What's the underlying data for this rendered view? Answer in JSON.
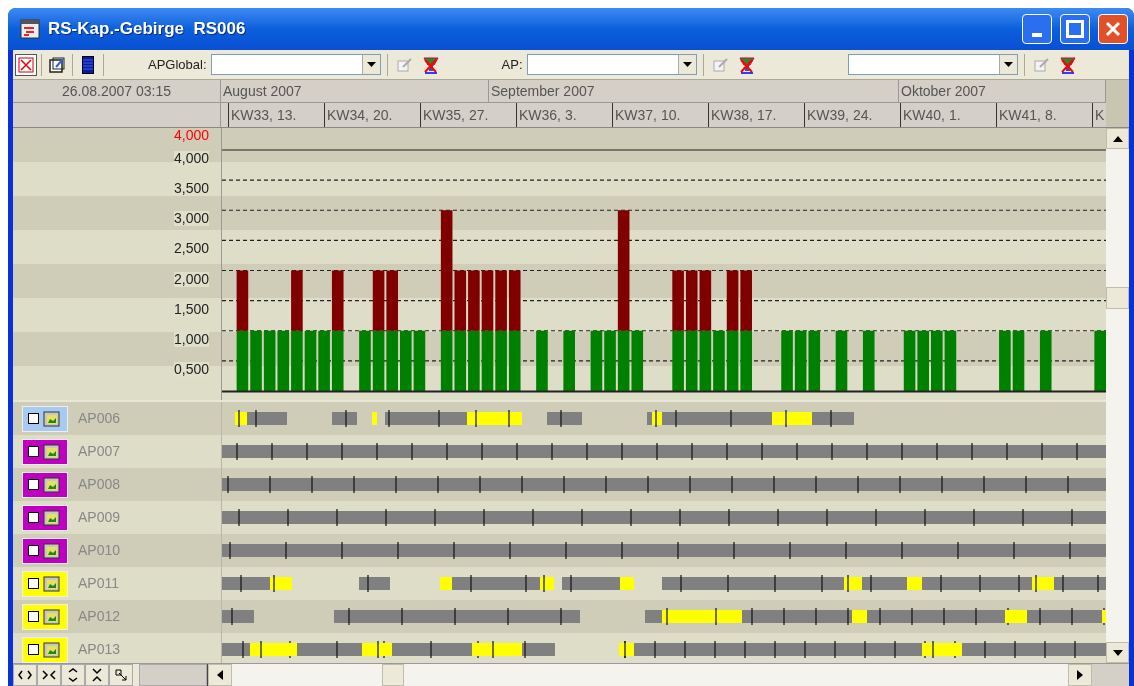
{
  "window": {
    "title": "RS-Kap.-Gebirge  RS006"
  },
  "toolbar": {
    "combos": [
      {
        "kind": "labeled",
        "label": "APGlobal:"
      },
      {
        "kind": "labeled",
        "label": "AP:"
      },
      {
        "kind": "plain"
      }
    ]
  },
  "timeline": {
    "datetime": "26.08.2007 03:15",
    "months": [
      "August 2007",
      "September 2007",
      "Oktober 2007"
    ],
    "weeks": [
      "KW33, 13.",
      "KW34, 20.",
      "KW35, 27.",
      "KW36, 3.",
      "KW37, 10.",
      "KW38, 17.",
      "KW39, 24.",
      "KW40, 1.",
      "KW41, 8.",
      "K"
    ]
  },
  "capacity_chart": {
    "chart_data": {
      "type": "bar",
      "stacked": true,
      "grid": true,
      "ylim": [
        0,
        4000
      ],
      "yticks": [
        {
          "value": 1000,
          "label": "1,000"
        },
        {
          "value": 1500,
          "label": "1,500"
        },
        {
          "value": 2000,
          "label": "2,000"
        },
        {
          "value": 2500,
          "label": "2,500"
        },
        {
          "value": 3000,
          "label": "3,000"
        },
        {
          "value": 3500,
          "label": "3,500"
        },
        {
          "value": 4000,
          "label": "4,000"
        }
      ],
      "annotations": [
        "4,000",
        "0,500"
      ],
      "series": [
        {
          "color": "#008000",
          "values": [
            null,
            1000,
            1000,
            1000,
            1000,
            1000,
            1000,
            1000,
            1000,
            null,
            1000,
            1000,
            1000,
            1000,
            1000,
            null,
            1000,
            1000,
            1000,
            1000,
            1000,
            1000,
            null,
            1000,
            null,
            1000,
            null,
            1000,
            1000,
            1000,
            1000,
            null,
            null,
            1000,
            1000,
            1000,
            1000,
            1000,
            1000,
            null,
            null,
            1000,
            1000,
            1000,
            null,
            1000,
            null,
            1000,
            null,
            null,
            1000,
            1000,
            1000,
            1000,
            null,
            null,
            null,
            1000,
            1000,
            null,
            1000,
            null,
            null,
            null,
            1000
          ]
        },
        {
          "color": "#800000",
          "values": [
            null,
            1000,
            null,
            null,
            null,
            1000,
            null,
            null,
            1000,
            null,
            null,
            1000,
            1000,
            null,
            null,
            null,
            2000,
            1000,
            1000,
            1000,
            1000,
            1000,
            null,
            null,
            null,
            null,
            null,
            null,
            null,
            2000,
            null,
            null,
            null,
            1000,
            1000,
            1000,
            null,
            1000,
            1000,
            null,
            null,
            null,
            null,
            null,
            null,
            null,
            null,
            null,
            null,
            null,
            null,
            null,
            null,
            null,
            null,
            null,
            null,
            null,
            null,
            null,
            null,
            null,
            null,
            null,
            null
          ]
        }
      ]
    }
  },
  "rows": [
    {
      "label": "AP006",
      "color": "#a6caf0",
      "checked": false
    },
    {
      "label": "AP007",
      "color": "#c000c0",
      "checked": false
    },
    {
      "label": "AP008",
      "color": "#c000c0",
      "checked": false
    },
    {
      "label": "AP009",
      "color": "#c000c0",
      "checked": false
    },
    {
      "label": "AP010",
      "color": "#c000c0",
      "checked": false
    },
    {
      "label": "AP011",
      "color": "#ffff00",
      "checked": false
    },
    {
      "label": "AP012",
      "color": "#ffff00",
      "checked": false
    },
    {
      "label": "AP013",
      "color": "#ffff00",
      "checked": false
    }
  ]
}
